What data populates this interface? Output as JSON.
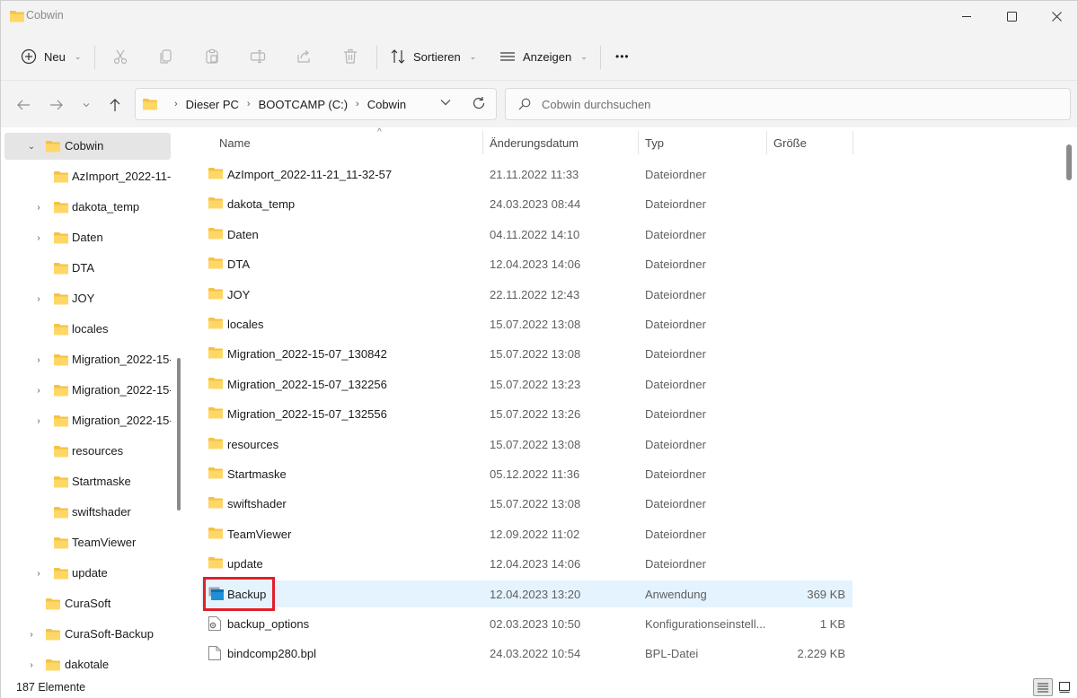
{
  "window": {
    "title": "Cobwin"
  },
  "commandbar": {
    "new_label": "Neu",
    "sort_label": "Sortieren",
    "view_label": "Anzeigen",
    "more_label": "•••"
  },
  "address": {
    "crumbs": [
      "Dieser PC",
      "BOOTCAMP (C:)",
      "Cobwin"
    ]
  },
  "search": {
    "placeholder": "Cobwin durchsuchen"
  },
  "navpane": {
    "items": [
      {
        "label": "Cobwin",
        "expanded": true,
        "selected": true
      },
      {
        "label": "AzImport_2022-11-"
      },
      {
        "label": "dakota_temp",
        "has_children": true
      },
      {
        "label": "Daten",
        "has_children": true
      },
      {
        "label": "DTA"
      },
      {
        "label": "JOY",
        "has_children": true
      },
      {
        "label": "locales"
      },
      {
        "label": "Migration_2022-15-",
        "has_children": true
      },
      {
        "label": "Migration_2022-15-",
        "has_children": true
      },
      {
        "label": "Migration_2022-15-",
        "has_children": true
      },
      {
        "label": "resources"
      },
      {
        "label": "Startmaske"
      },
      {
        "label": "swiftshader"
      },
      {
        "label": "TeamViewer"
      },
      {
        "label": "update",
        "has_children": true
      },
      {
        "label": "CuraSoft"
      },
      {
        "label": "CuraSoft-Backup",
        "has_children": true
      },
      {
        "label": "dakotale",
        "has_children": true
      }
    ]
  },
  "columns": {
    "name": "Name",
    "date": "Änderungsdatum",
    "type": "Typ",
    "size": "Größe"
  },
  "files": [
    {
      "name": "AzImport_2022-11-21_11-32-57",
      "date": "21.11.2022 11:33",
      "type": "Dateiordner",
      "size": "",
      "icon": "folder-icon"
    },
    {
      "name": "dakota_temp",
      "date": "24.03.2023 08:44",
      "type": "Dateiordner",
      "size": "",
      "icon": "folder-icon"
    },
    {
      "name": "Daten",
      "date": "04.11.2022 14:10",
      "type": "Dateiordner",
      "size": "",
      "icon": "folder-icon"
    },
    {
      "name": "DTA",
      "date": "12.04.2023 14:06",
      "type": "Dateiordner",
      "size": "",
      "icon": "folder-icon"
    },
    {
      "name": "JOY",
      "date": "22.11.2022 12:43",
      "type": "Dateiordner",
      "size": "",
      "icon": "folder-icon"
    },
    {
      "name": "locales",
      "date": "15.07.2022 13:08",
      "type": "Dateiordner",
      "size": "",
      "icon": "folder-icon"
    },
    {
      "name": "Migration_2022-15-07_130842",
      "date": "15.07.2022 13:08",
      "type": "Dateiordner",
      "size": "",
      "icon": "folder-icon"
    },
    {
      "name": "Migration_2022-15-07_132256",
      "date": "15.07.2022 13:23",
      "type": "Dateiordner",
      "size": "",
      "icon": "folder-icon"
    },
    {
      "name": "Migration_2022-15-07_132556",
      "date": "15.07.2022 13:26",
      "type": "Dateiordner",
      "size": "",
      "icon": "folder-icon"
    },
    {
      "name": "resources",
      "date": "15.07.2022 13:08",
      "type": "Dateiordner",
      "size": "",
      "icon": "folder-icon"
    },
    {
      "name": "Startmaske",
      "date": "05.12.2022 11:36",
      "type": "Dateiordner",
      "size": "",
      "icon": "folder-icon"
    },
    {
      "name": "swiftshader",
      "date": "15.07.2022 13:08",
      "type": "Dateiordner",
      "size": "",
      "icon": "folder-icon"
    },
    {
      "name": "TeamViewer",
      "date": "12.09.2022 11:02",
      "type": "Dateiordner",
      "size": "",
      "icon": "folder-icon"
    },
    {
      "name": "update",
      "date": "12.04.2023 14:06",
      "type": "Dateiordner",
      "size": "",
      "icon": "folder-icon"
    },
    {
      "name": "Backup",
      "date": "12.04.2023 13:20",
      "type": "Anwendung",
      "size": "369 KB",
      "icon": "application-icon",
      "highlighted": true
    },
    {
      "name": "backup_options",
      "date": "02.03.2023 10:50",
      "type": "Konfigurationseinstell...",
      "size": "1 KB",
      "icon": "config-file-icon"
    },
    {
      "name": "bindcomp280.bpl",
      "date": "24.03.2022 10:54",
      "type": "BPL-Datei",
      "size": "2.229 KB",
      "icon": "file-icon"
    }
  ],
  "status": {
    "count": "187 Elemente"
  },
  "colors": {
    "folder": "#f5c242",
    "highlight_row": "#e5f3ff",
    "annotation_box": "#e0202a",
    "accent": "#0067c0"
  }
}
